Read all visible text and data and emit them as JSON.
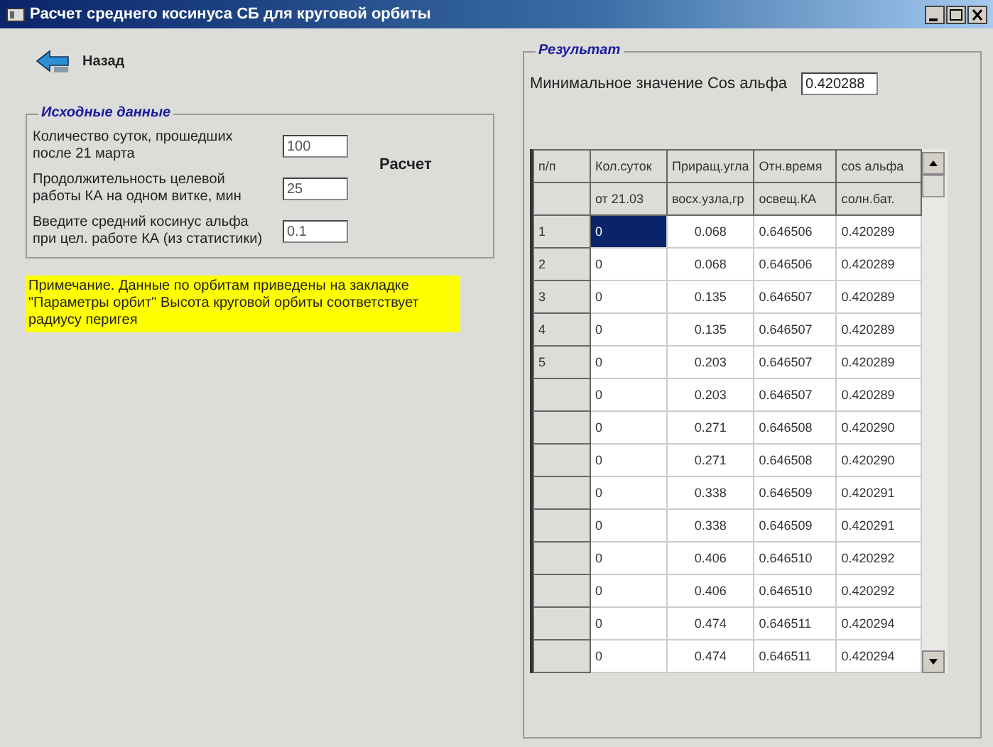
{
  "window": {
    "title": "Расчет среднего косинуса СБ для круговой орбиты"
  },
  "back_button": {
    "label": "Назад"
  },
  "input_group": {
    "title": "Исходные данные",
    "fields": [
      {
        "label": "Количество суток, прошедших после 21 марта",
        "value": "100"
      },
      {
        "label": "Продолжительность целевой работы КА на одном витке, мин",
        "value": "25"
      },
      {
        "label": "Введите средний косинус альфа при цел. работе КА (из статистики)",
        "value": "0.1"
      }
    ],
    "calc_button": "Расчет"
  },
  "note": "Примечание. Данные по орбитам  приведены на закладке \"Параметры орбит\"  Высота круговой орбиты соответствует радиусу перигея",
  "result_group": {
    "title": "Результат",
    "min_label": "Минимальное значение Cos альфа",
    "min_value": "0.420288"
  },
  "table": {
    "header_rows": [
      [
        "п/п",
        "Кол.суток",
        "Приращ.угла",
        "Отн.время",
        "cos альфа"
      ],
      [
        "",
        "от 21.03",
        "восх.узла,гр",
        "освещ.КА",
        "солн.бат."
      ]
    ],
    "rows": [
      {
        "cells": [
          "1",
          "0",
          "0.068",
          "0.646506",
          "0.420289"
        ],
        "selected": true
      },
      {
        "cells": [
          "2",
          "0",
          "0.068",
          "0.646506",
          "0.420289"
        ],
        "selected": false
      },
      {
        "cells": [
          "3",
          "0",
          "0.135",
          "0.646507",
          "0.420289"
        ],
        "selected": false
      },
      {
        "cells": [
          "4",
          "0",
          "0.135",
          "0.646507",
          "0.420289"
        ],
        "selected": false
      },
      {
        "cells": [
          "5",
          "0",
          "0.203",
          "0.646507",
          "0.420289"
        ],
        "selected": false
      },
      {
        "cells": [
          "",
          "0",
          "0.203",
          "0.646507",
          "0.420289"
        ],
        "selected": false
      },
      {
        "cells": [
          "",
          "0",
          "0.271",
          "0.646508",
          "0.420290"
        ],
        "selected": false
      },
      {
        "cells": [
          "",
          "0",
          "0.271",
          "0.646508",
          "0.420290"
        ],
        "selected": false
      },
      {
        "cells": [
          "",
          "0",
          "0.338",
          "0.646509",
          "0.420291"
        ],
        "selected": false
      },
      {
        "cells": [
          "",
          "0",
          "0.338",
          "0.646509",
          "0.420291"
        ],
        "selected": false
      },
      {
        "cells": [
          "",
          "0",
          "0.406",
          "0.646510",
          "0.420292"
        ],
        "selected": false
      },
      {
        "cells": [
          "",
          "0",
          "0.406",
          "0.646510",
          "0.420292"
        ],
        "selected": false
      },
      {
        "cells": [
          "",
          "0",
          "0.474",
          "0.646511",
          "0.420294"
        ],
        "selected": false
      },
      {
        "cells": [
          "",
          "0",
          "0.474",
          "0.646511",
          "0.420294"
        ],
        "selected": false
      }
    ]
  }
}
